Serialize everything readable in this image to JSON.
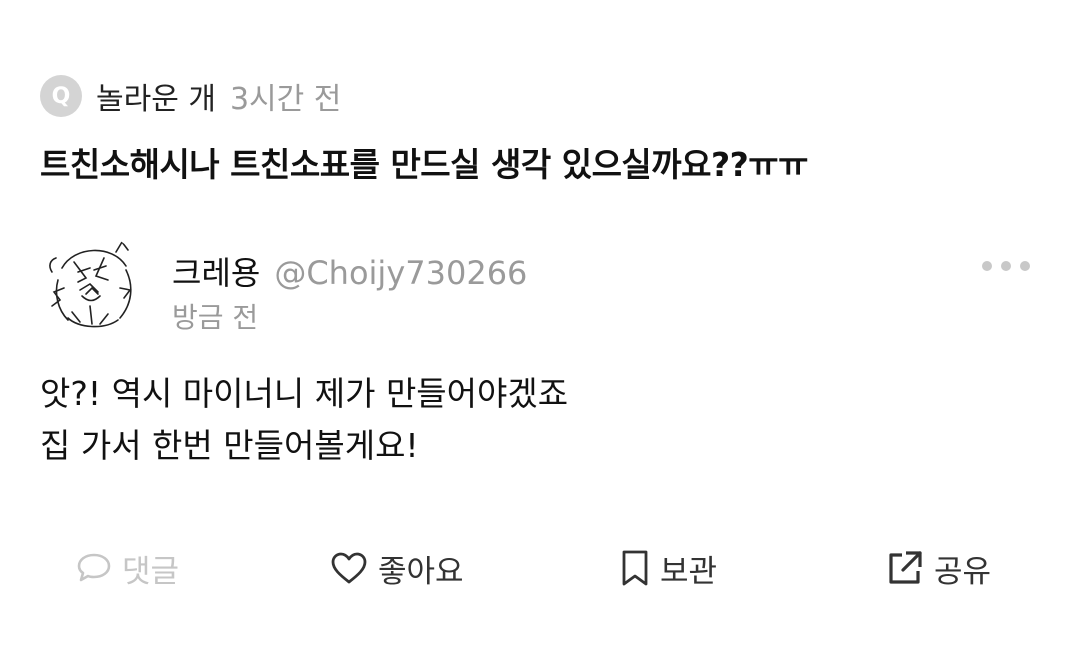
{
  "question": {
    "badge": "Q",
    "asker": "놀라운 개",
    "time": "3시간 전",
    "text": "트친소해시나 트친소표를 만드실 생각 있으실까요??ㅠㅠ"
  },
  "answer": {
    "author_name": "크레용",
    "author_handle": "@Choijy730266",
    "time": "방금 전",
    "lines": [
      "앗?! 역시 마이너니 제가 만들어야겠죠",
      "집 가서 한번 만들어볼게요!"
    ]
  },
  "actions": {
    "comment_label": "댓글",
    "like_label": "좋아요",
    "save_label": "보관",
    "share_label": "공유"
  },
  "icons": {
    "question": "q-badge-icon",
    "more": "more-dots-icon",
    "comment": "comment-bubble-icon",
    "like": "heart-icon",
    "save": "bookmark-icon",
    "share": "share-arrow-icon"
  },
  "colors": {
    "muted_text": "#9a9a9a",
    "disabled_action": "#c6c6c6",
    "badge_bg": "#d4d4d4"
  }
}
